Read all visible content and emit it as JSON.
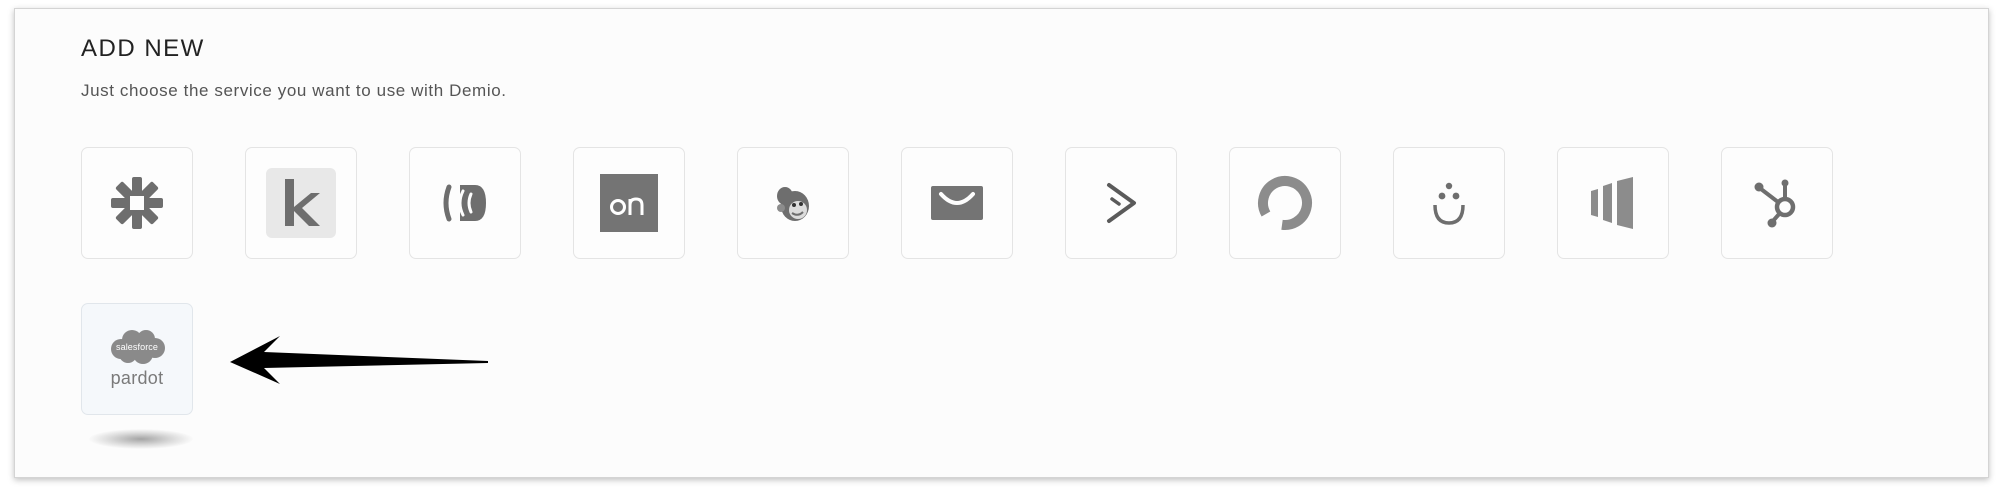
{
  "header": {
    "title": "ADD NEW",
    "subtitle": "Just choose the service you want to use with Demio."
  },
  "services": [
    {
      "icon": "zapier-icon"
    },
    {
      "icon": "keap-icon"
    },
    {
      "icon": "convertkit-icon"
    },
    {
      "icon": "ontraport-icon"
    },
    {
      "icon": "mailchimp-icon"
    },
    {
      "icon": "getresponse-icon"
    },
    {
      "icon": "activecampaign-icon"
    },
    {
      "icon": "constantcontact-icon"
    },
    {
      "icon": "drip-icon"
    },
    {
      "icon": "marketo-icon"
    },
    {
      "icon": "hubspot-icon"
    },
    {
      "icon": "pardot-icon",
      "cloud_text": "salesforce",
      "text": "pardot",
      "highlighted": true
    }
  ],
  "colors": {
    "icon_gray": "#6e6e6e",
    "icon_light_gray": "#8c8c8c",
    "arrow": "#000000",
    "salesforce_cloud": "#8a8a8a"
  }
}
